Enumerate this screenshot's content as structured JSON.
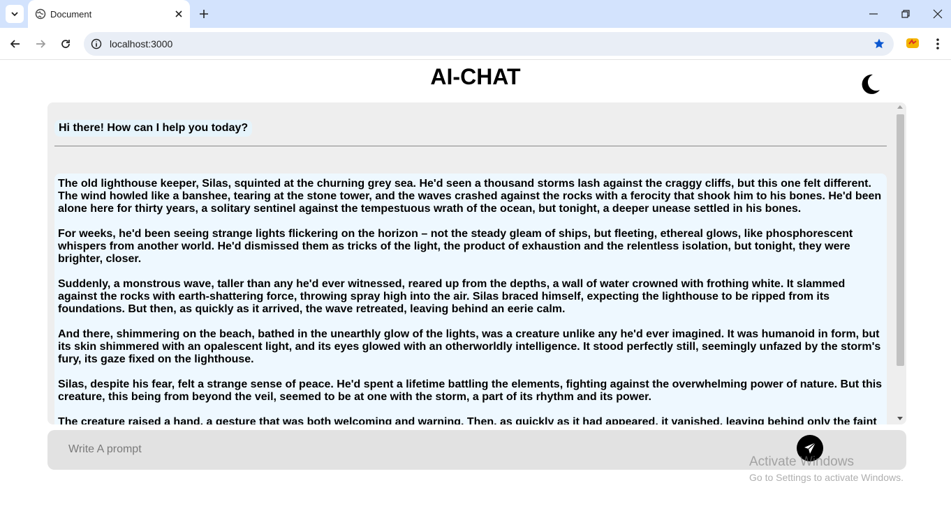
{
  "browser": {
    "tab_title": "Document",
    "url": "localhost:3000"
  },
  "app": {
    "title": "AI-CHAT"
  },
  "chat": {
    "greeting": "Hi there! How can I help you today?",
    "response_paragraphs": [
      "The old lighthouse keeper, Silas, squinted at the churning grey sea. He'd seen a thousand storms lash against the craggy cliffs, but this one felt different. The wind howled like a banshee, tearing at the stone tower, and the waves crashed against the rocks with a ferocity that shook him to his bones. He'd been alone here for thirty years, a solitary sentinel against the tempestuous wrath of the ocean, but tonight, a deeper unease settled in his bones.",
      "For weeks, he'd been seeing strange lights flickering on the horizon – not the steady gleam of ships, but fleeting, ethereal glows, like phosphorescent whispers from another world. He'd dismissed them as tricks of the light, the product of exhaustion and the relentless isolation, but tonight, they were brighter, closer.",
      "Suddenly, a monstrous wave, taller than any he'd ever witnessed, reared up from the depths, a wall of water crowned with frothing white. It slammed against the rocks with earth-shattering force, throwing spray high into the air. Silas braced himself, expecting the lighthouse to be ripped from its foundations. But then, as quickly as it arrived, the wave retreated, leaving behind an eerie calm.",
      "And there, shimmering on the beach, bathed in the unearthly glow of the lights, was a creature unlike any he'd ever imagined. It was humanoid in form, but its skin shimmered with an opalescent light, and its eyes glowed with an otherworldly intelligence. It stood perfectly still, seemingly unfazed by the storm's fury, its gaze fixed on the lighthouse.",
      "Silas, despite his fear, felt a strange sense of peace. He'd spent a lifetime battling the elements, fighting against the overwhelming power of nature. But this creature, this being from beyond the veil, seemed to be at one with the storm, a part of its rhythm and its power.",
      "The creature raised a hand, a gesture that was both welcoming and warning. Then, as quickly as it had appeared, it vanished, leaving behind only the faint"
    ]
  },
  "prompt": {
    "placeholder": "Write A prompt",
    "value": ""
  },
  "watermark": {
    "title": "Activate Windows",
    "subtitle": "Go to Settings to activate Windows."
  },
  "icons": {
    "theme": "moon-icon",
    "send": "paper-plane-icon"
  },
  "colors": {
    "chat_bg": "#eeeeee",
    "response_bg": "#eef8ff",
    "prompt_bg": "#e2e2e2",
    "accent": "#000000"
  }
}
